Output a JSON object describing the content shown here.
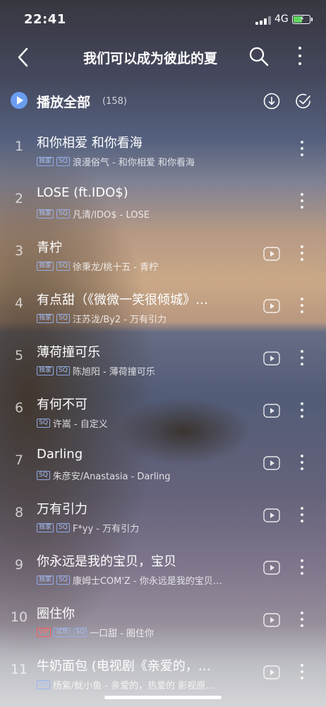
{
  "status_bar": {
    "time": "22:41",
    "network": "4G"
  },
  "header": {
    "title": "我们可以成为彼此的夏",
    "icons": [
      "back-icon",
      "search-icon",
      "more-icon"
    ]
  },
  "play_all": {
    "label": "播放全部",
    "count": "(158)",
    "icons": [
      "play-icon",
      "download-icon",
      "multi-select-icon"
    ]
  },
  "songs": [
    {
      "index": "1",
      "title": "和你相爱 和你看海",
      "tags": [
        "独家",
        "SQ"
      ],
      "meta": "浪漫俗气 - 和你相爱 和你看海",
      "mv": false
    },
    {
      "index": "2",
      "title": "LOSE (ft.IDO$)",
      "tags": [
        "独家",
        "SQ"
      ],
      "meta": "凡清/IDO$ - LOSE",
      "mv": false
    },
    {
      "index": "3",
      "title": "青柠",
      "tags": [
        "独家",
        "SQ"
      ],
      "meta": "徐秉龙/桃十五 - 青柠",
      "mv": true
    },
    {
      "index": "4",
      "title": "有点甜（《微微一笑很倾城》…",
      "tags": [
        "独家",
        "SQ"
      ],
      "meta": "汪苏泷/By2 - 万有引力",
      "mv": true
    },
    {
      "index": "5",
      "title": "薄荷撞可乐",
      "tags": [
        "独家",
        "SQ"
      ],
      "meta": "陈旭阳 - 薄荷撞可乐",
      "mv": true
    },
    {
      "index": "6",
      "title": "有何不可",
      "tags": [
        "SQ"
      ],
      "meta": "许嵩 - 自定义",
      "mv": true
    },
    {
      "index": "7",
      "title": "Darling",
      "tags": [
        "SQ"
      ],
      "meta": "朱彦安/Anastasia - Darling",
      "mv": true
    },
    {
      "index": "8",
      "title": "万有引力",
      "tags": [
        "独家",
        "SQ"
      ],
      "meta": "F*yy - 万有引力",
      "mv": true
    },
    {
      "index": "9",
      "title": "你永远是我的宝贝，宝贝",
      "tags": [
        "独家",
        "SQ"
      ],
      "meta": "康姆士COM'Z - 你永远是我的宝贝…",
      "mv": true
    },
    {
      "index": "10",
      "title": "圈住你",
      "tags": [
        "VIP",
        "试听",
        "SQ"
      ],
      "meta": "一口甜 - 圈住你",
      "mv": true
    },
    {
      "index": "11",
      "title": "牛奶面包 (电视剧《亲爱的，…",
      "tags": [
        "SQ"
      ],
      "meta": "杨紫/魷小鱼 - 亲爱的，热爱的 影视原…",
      "mv": true
    }
  ]
}
